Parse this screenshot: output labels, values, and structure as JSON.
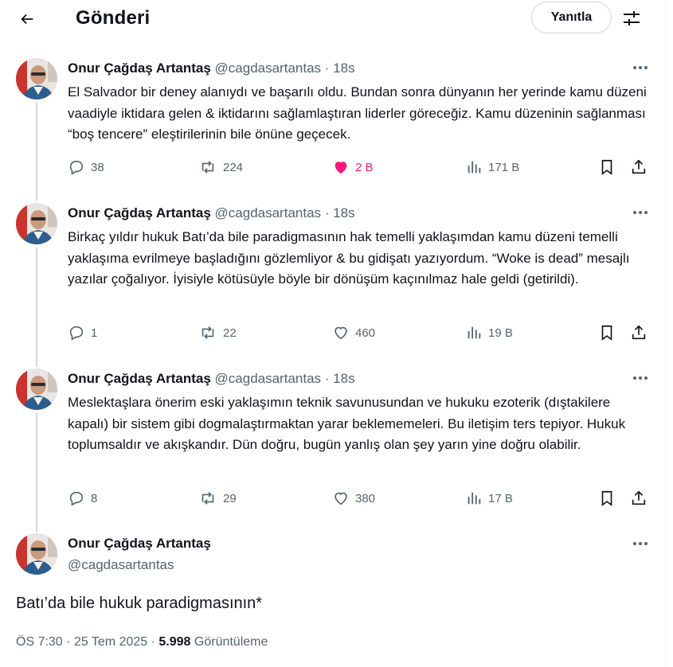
{
  "header": {
    "title": "Gönderi",
    "reply_label": "Yanıtla",
    "back_icon": "arrow-left-icon",
    "settings_icon": "sliders-icon"
  },
  "colors": {
    "like_active": "#f91880",
    "muted": "#536471",
    "text": "#0f1419",
    "border": "#cfd9de"
  },
  "tweets": [
    {
      "name": "Onur Çağdaş Artantaş",
      "handle": "@cagdasartantas",
      "time": "· 18s",
      "text": "El Salvador bir deney alanıydı ve başarılı oldu. Bundan sonra dünyanın her yerinde kamu düzeni vaadiyle iktidara gelen & iktidarını sağlamlaştıran liderler göreceğiz. Kamu düzeninin sağlanması “boş tencere” eleştirilerinin bile önüne geçecek.",
      "replies": "38",
      "reposts": "224",
      "likes": "2 B",
      "liked": true,
      "views": "171 B"
    },
    {
      "name": "Onur Çağdaş Artantaş",
      "handle": "@cagdasartantas",
      "time": "· 18s",
      "text": "Birkaç yıldır hukuk Batı’da bile paradigmasının hak temelli yaklaşımdan kamu düzeni temelli yaklaşıma evrilmeye başladığını gözlemliyor & bu gidişatı yazıyordum. “Woke is dead” mesajlı yazılar çoğalıyor. İyisiyle kötüsüyle böyle bir dönüşüm kaçınılmaz hale geldi (getirildi).",
      "replies": "1",
      "reposts": "22",
      "likes": "460",
      "liked": false,
      "views": "19 B"
    },
    {
      "name": "Onur Çağdaş Artantaş",
      "handle": "@cagdasartantas",
      "time": "· 18s",
      "text": "Meslektaşlara önerim eski yaklaşımın teknik savunusundan ve hukuku ezoterik (dıştakilere kapalı) bir sistem gibi dogmalaştırmaktan yarar beklememeleri. Bu iletişim ters tepiyor. Hukuk toplumsaldır ve akışkandır. Dün doğru, bugün yanlış olan şey yarın yine doğru olabilir.",
      "replies": "8",
      "reposts": "29",
      "likes": "380",
      "liked": false,
      "views": "17 B"
    }
  ],
  "focal": {
    "name": "Onur Çağdaş Artantaş",
    "handle": "@cagdasartantas",
    "text": "Batı’da bile hukuk paradigmasının*",
    "time": "ÖS 7:30",
    "date": "25 Tem 2025",
    "views": "5.998",
    "views_label": "Görüntüleme"
  }
}
